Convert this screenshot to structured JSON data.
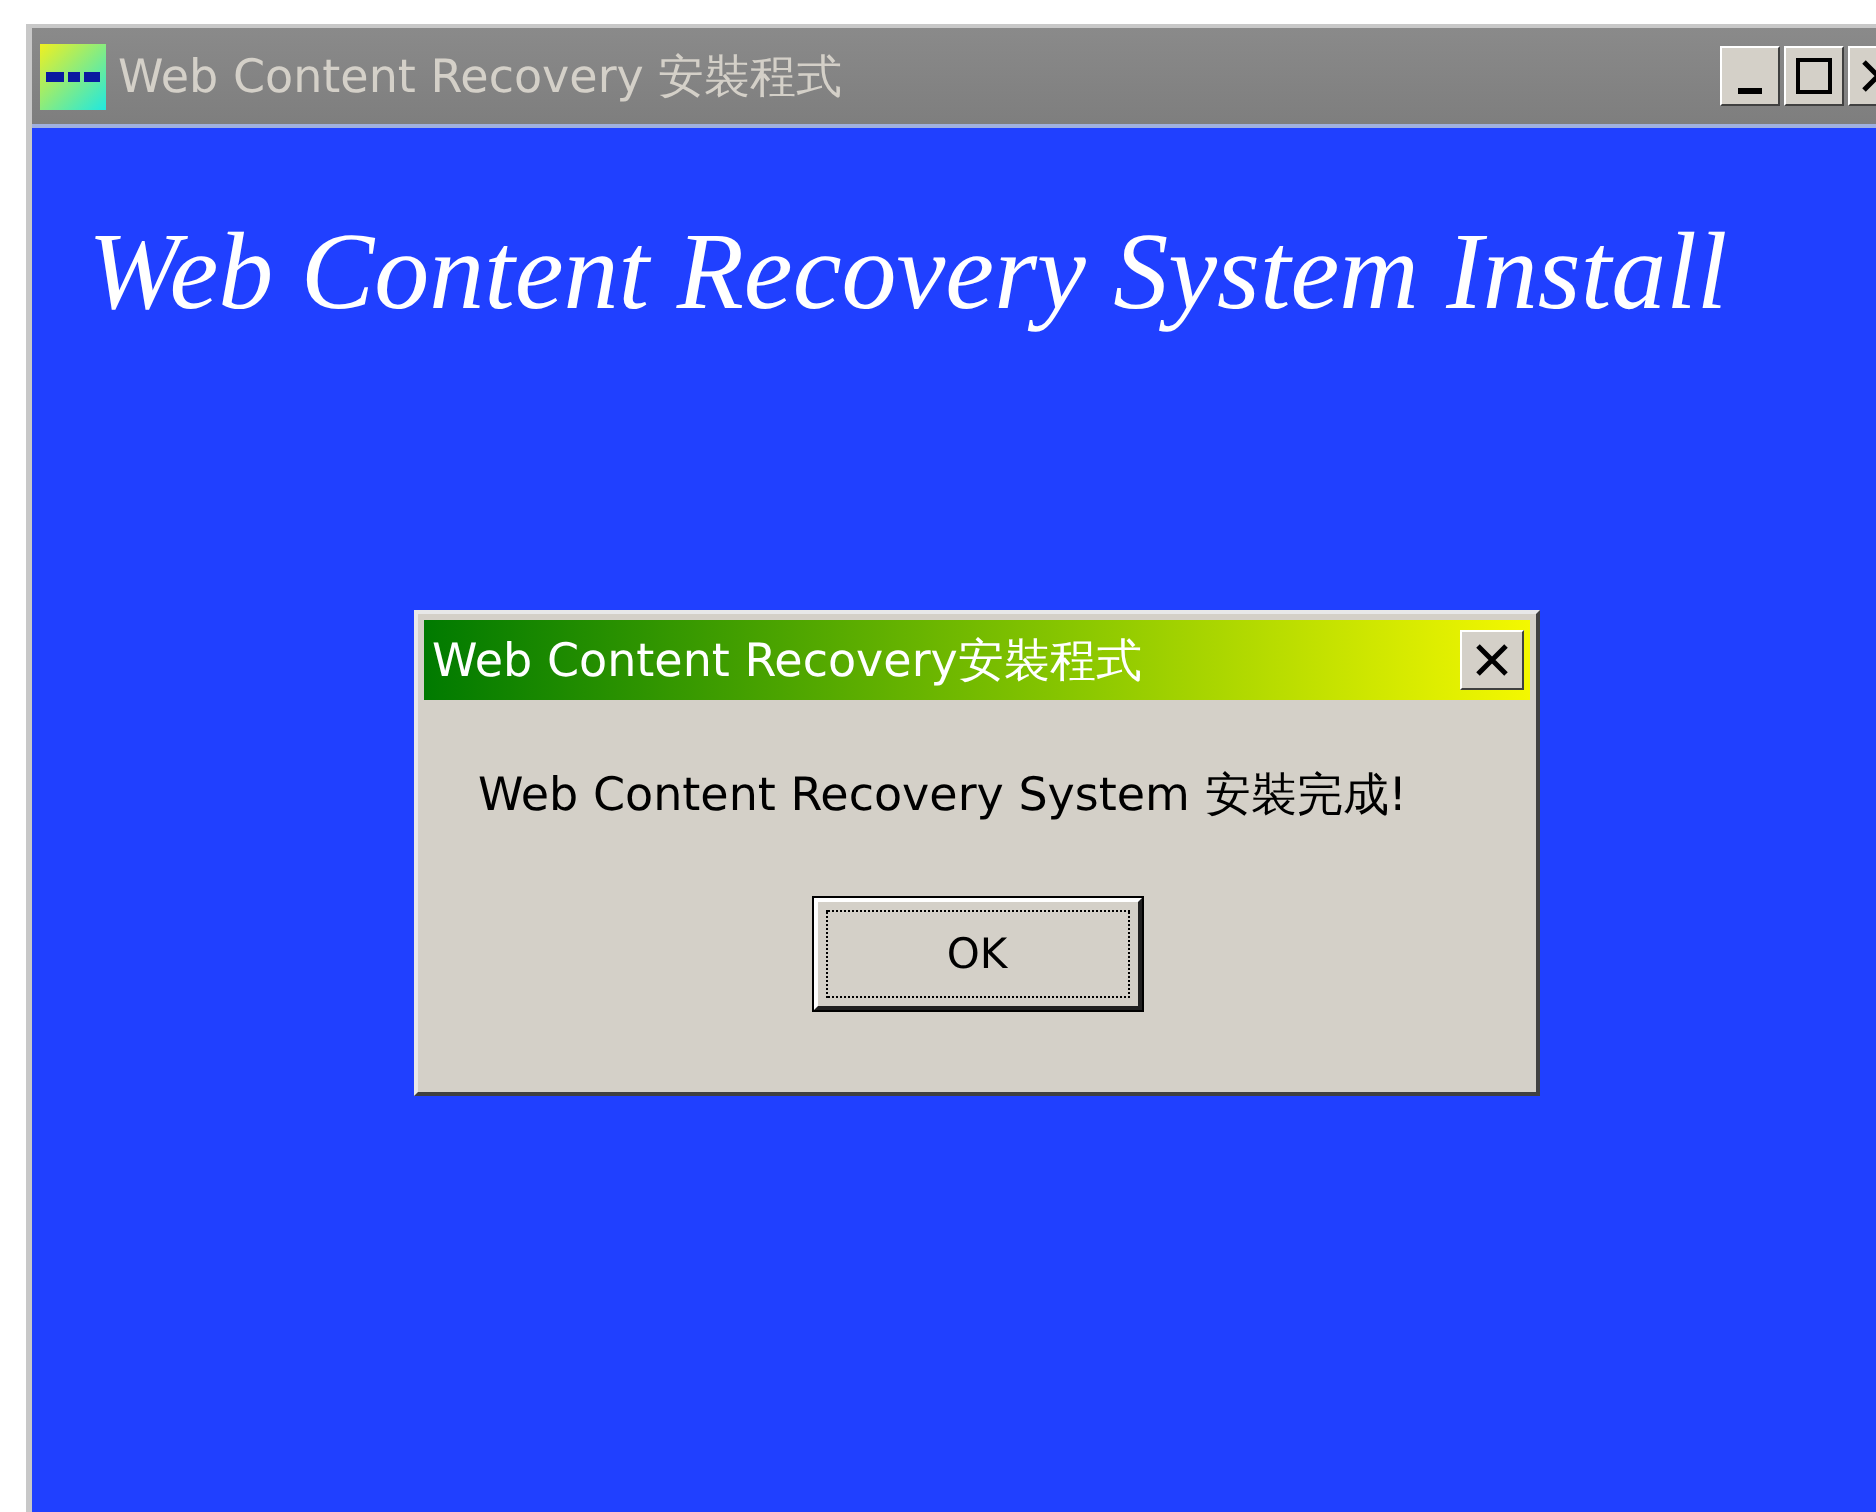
{
  "window": {
    "title": "Web Content Recovery 安裝程式",
    "active": false,
    "controls": [
      {
        "kind": "minimize"
      },
      {
        "kind": "maximize"
      },
      {
        "kind": "close"
      }
    ]
  },
  "heading": "Web Content Recovery System Install",
  "dialog": {
    "title": "Web Content Recovery安裝程式",
    "message": "Web Content Recovery System 安裝完成!",
    "buttons": [
      {
        "label": "OK",
        "focused": true
      }
    ]
  }
}
